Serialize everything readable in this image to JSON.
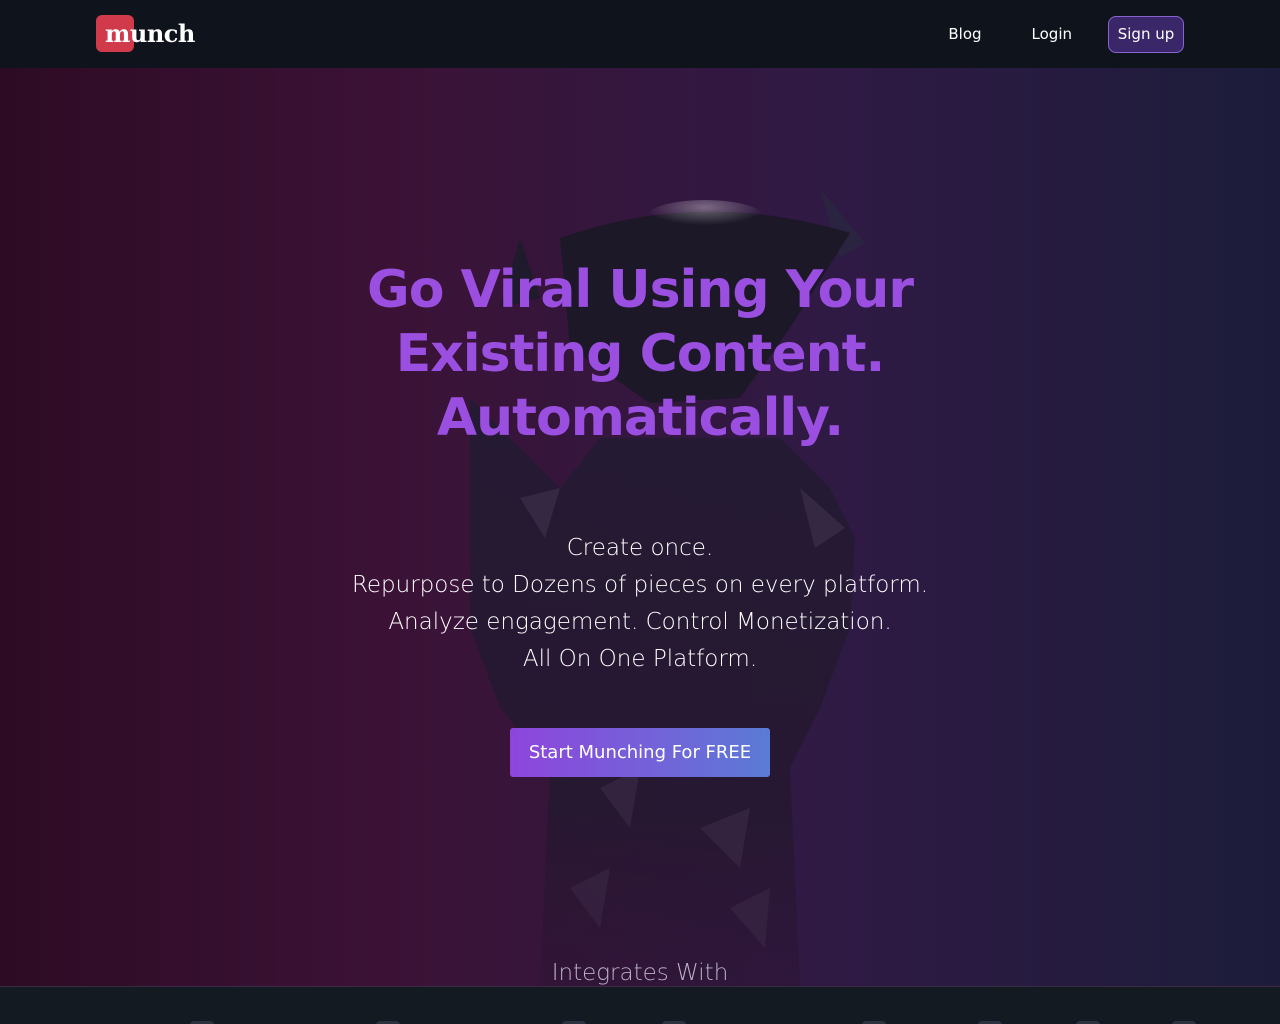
{
  "header": {
    "logo_text": "munch",
    "nav": [
      {
        "label": "Blog"
      },
      {
        "label": "Login"
      }
    ],
    "signup_label": "Sign up"
  },
  "hero": {
    "title_lines": [
      "Go Viral Using Your",
      "Existing Content.",
      "Automatically."
    ],
    "subtitle_lines": [
      "Create once.",
      "Repurpose to Dozens of pieces on every platform.",
      "Analyze engagement. Control Monetization.",
      "All On One Platform."
    ],
    "cta_label": "Start Munching For FREE",
    "integrates_label": "Integrates With"
  },
  "colors": {
    "accent": "#9b4fe0",
    "logo_red": "#d13a4a",
    "nav_bg": "#0f141c"
  },
  "integration_icons": [
    "integration-icon-1",
    "integration-icon-2",
    "integration-icon-3",
    "integration-icon-4",
    "integration-icon-5",
    "integration-icon-6",
    "integration-icon-7",
    "integration-icon-8"
  ]
}
